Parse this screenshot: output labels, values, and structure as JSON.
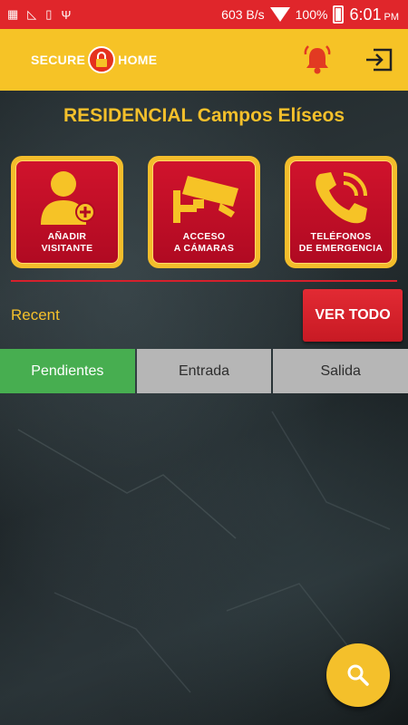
{
  "status_bar": {
    "net_speed": "603 B/s",
    "battery": "100%",
    "time": "6:01",
    "ampm": "PM"
  },
  "app_bar": {
    "logo_left": "SECURE",
    "logo_right": "HOME",
    "icons": [
      "bell-icon",
      "logout-icon"
    ]
  },
  "title": "RESIDENCIAL Campos Elíseos",
  "tiles": [
    {
      "line1": "AÑADIR",
      "line2": "VISITANTE",
      "icon": "add-user-icon"
    },
    {
      "line1": "ACCESO",
      "line2": "A CÁMARAS",
      "icon": "camera-icon"
    },
    {
      "line1": "TELÉFONOS",
      "line2": "DE EMERGENCIA",
      "icon": "phone-icon"
    }
  ],
  "recent_label": "Recent",
  "ver_todo": "VER TODO",
  "tabs": [
    {
      "label": "Pendientes",
      "active": true
    },
    {
      "label": "Entrada",
      "active": false
    },
    {
      "label": "Salida",
      "active": false
    }
  ],
  "fab_icon": "search-icon",
  "colors": {
    "status_red": "#e0262b",
    "brand_yellow": "#f6c326",
    "tile_red": "#c20f27",
    "active_green": "#47ae50"
  }
}
